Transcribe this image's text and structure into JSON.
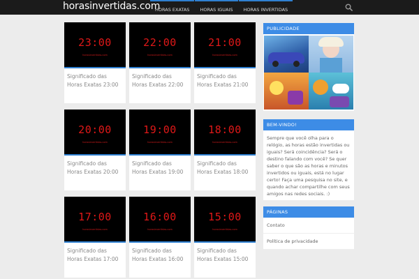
{
  "header": {
    "logo": "horasinvertidas.com",
    "nav": [
      "HORAS EXATAS",
      "HORAS IGUAIS",
      "HORAS INVERTIDAS"
    ]
  },
  "cards": [
    {
      "time": "23:00",
      "site": "horasinvertidas.com",
      "title": "Significado das Horas Exatas 23:00"
    },
    {
      "time": "22:00",
      "site": "horasinvertidas.com",
      "title": "Significado das Horas Exatas 22:00"
    },
    {
      "time": "21:00",
      "site": "horasinvertidas.com",
      "title": "Significado das Horas Exatas 21:00"
    },
    {
      "time": "20:00",
      "site": "horasinvertidas.com",
      "title": "Significado das Horas Exatas 20:00"
    },
    {
      "time": "19:00",
      "site": "horasinvertidas.com",
      "title": "Significado das Horas Exatas 19:00"
    },
    {
      "time": "18:00",
      "site": "horasinvertidas.com",
      "title": "Significado das Horas Exatas 18:00"
    },
    {
      "time": "17:00",
      "site": "horasinvertidas.com",
      "title": "Significado das Horas Exatas 17:00"
    },
    {
      "time": "16:00",
      "site": "horasinvertidas.com",
      "title": "Significado das Horas Exatas 16:00"
    },
    {
      "time": "15:00",
      "site": "horasinvertidas.com",
      "title": "Significado das Horas Exatas 15:00"
    }
  ],
  "sidebar": {
    "ads": {
      "title": "PUBLICIDADE"
    },
    "welcome": {
      "title": "BEM-VINDO!",
      "text": "Sempre que você olha para o relógio, as horas estão invertidas ou iguais? Será coincidência? Será o destino falando com você? Se quer saber o que são as horas e minutos invertidos ou iguais, está no lugar certo! Faça uma pesquisa no site, e quando achar compartilhe com seus amigos nas redes sociais. :)"
    },
    "pages": {
      "title": "PÁGINAS",
      "links": [
        "Contato",
        "Política de privacidade"
      ]
    }
  },
  "colors": {
    "accent": "#3d8ce6",
    "clock_digits": "#e01818",
    "header_bg": "#1b1b1b"
  }
}
